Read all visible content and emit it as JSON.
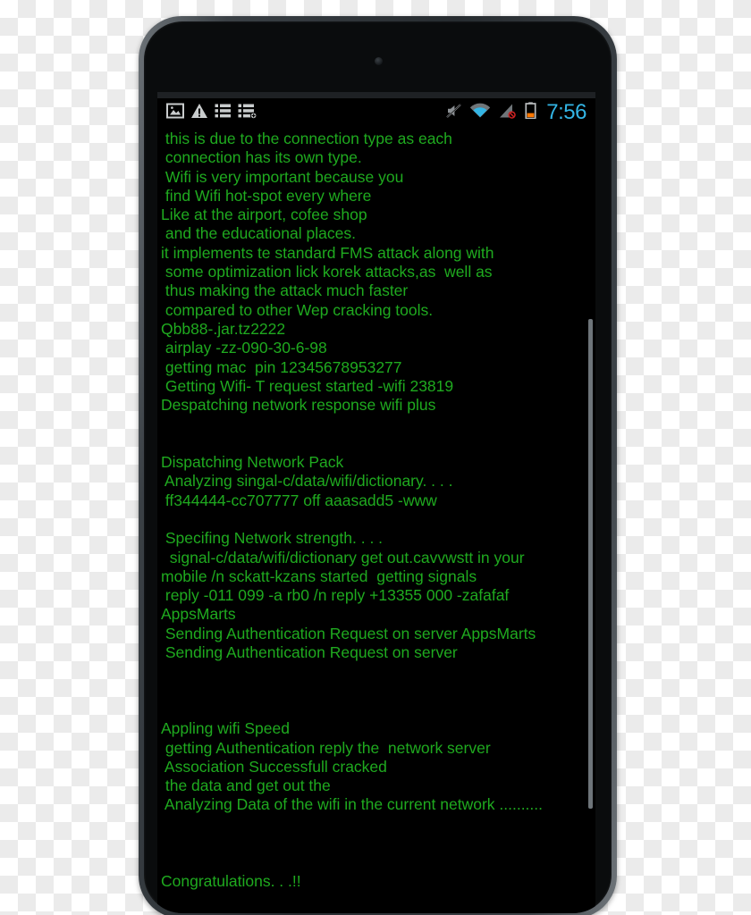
{
  "device": {
    "camera_icon": "front-camera-dot"
  },
  "statusbar": {
    "left_icons": [
      {
        "name": "image-icon",
        "glyph": "picture"
      },
      {
        "name": "warning-icon",
        "glyph": "warning-triangle"
      },
      {
        "name": "list-icon",
        "glyph": "list"
      },
      {
        "name": "list-add-icon",
        "glyph": "list-plus"
      }
    ],
    "right_icons": [
      {
        "name": "mute-icon",
        "glyph": "speaker-muted"
      },
      {
        "name": "wifi-icon",
        "glyph": "wifi",
        "color": "#33b5e5"
      },
      {
        "name": "no-signal-icon",
        "glyph": "signal-blocked"
      },
      {
        "name": "battery-icon",
        "glyph": "battery",
        "color": "#ff7700"
      }
    ],
    "clock": "7:56",
    "clock_color": "#33b5e5"
  },
  "console": {
    "text_color": "#1faa1f",
    "background_color": "#000000",
    "lines": [
      " this is due to the connection type as each",
      " connection has its own type.",
      " Wifi is very important because you",
      " find Wifi hot-spot every where",
      "Like at the airport, cofee shop",
      " and the educational places.",
      "it implements te standard FMS attack along with",
      " some optimization lick korek attacks,as  well as",
      " thus making the attack much faster",
      " compared to other Wep cracking tools.",
      "Qbb88-.jar.tz2222",
      " airplay -zz-090-30-6-98",
      " getting mac  pin 12345678953277",
      " Getting Wifi- T request started -wifi 23819",
      "Despatching network response wifi plus",
      "",
      "",
      "Dispatching Network Pack",
      " Analyzing singal-c/data/wifi/dictionary. . . .",
      " ff344444-cc707777 off aaasadd5 -www",
      "",
      " Specifing Network strength. . . .",
      "  signal-c/data/wifi/dictionary get out.cavvwstt in your",
      "mobile /n sckatt-kzans started  getting signals",
      " reply -011 099 -a rb0 /n reply +13355 000 -zafafaf",
      "AppsMarts",
      " Sending Authentication Request on server AppsMarts",
      " Sending Authentication Request on server",
      "",
      "",
      "",
      "Appling wifi Speed",
      " getting Authentication reply the  network server",
      " Association Successfull cracked",
      " the data and get out the",
      " Analyzing Data of the wifi in the current network ..........",
      "",
      "",
      "",
      "Congratulations. . .!!"
    ]
  },
  "scrollbar": {
    "name": "vertical-scrollbar",
    "color": "#6e757a"
  }
}
